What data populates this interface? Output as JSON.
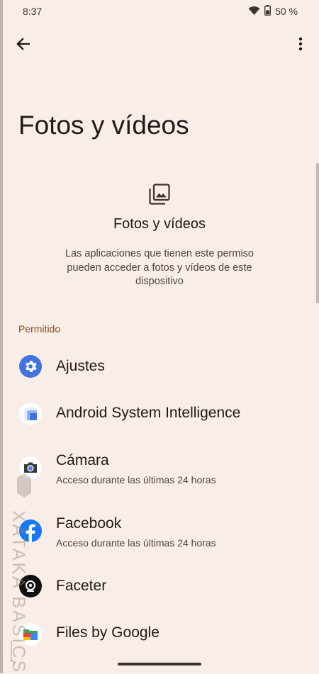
{
  "status_bar": {
    "time": "8:37",
    "battery": "50 %"
  },
  "page": {
    "title": "Fotos y vídeos",
    "section_heading": "Fotos y vídeos",
    "section_desc": "Las aplicaciones que tienen este permiso pueden acceder a fotos y vídeos de este dispositivo",
    "category": "Permitido"
  },
  "apps": [
    {
      "name": "Ajustes",
      "subtitle": "",
      "icon": "settings-icon"
    },
    {
      "name": "Android System Intelligence",
      "subtitle": "",
      "icon": "android-system-intelligence-icon"
    },
    {
      "name": "Cámara",
      "subtitle": "Acceso durante las últimas 24 horas",
      "icon": "camera-icon"
    },
    {
      "name": "Facebook",
      "subtitle": "Acceso durante las últimas 24 horas",
      "icon": "facebook-icon"
    },
    {
      "name": "Faceter",
      "subtitle": "",
      "icon": "faceter-icon"
    },
    {
      "name": "Files by Google",
      "subtitle": "",
      "icon": "files-by-google-icon"
    }
  ],
  "watermark": "XATAKA BASICS",
  "colors": {
    "background": "#f9ede8",
    "accent": "#8b4a1d",
    "settings_blue": "#3f73e0",
    "facebook_blue": "#1877f2"
  }
}
